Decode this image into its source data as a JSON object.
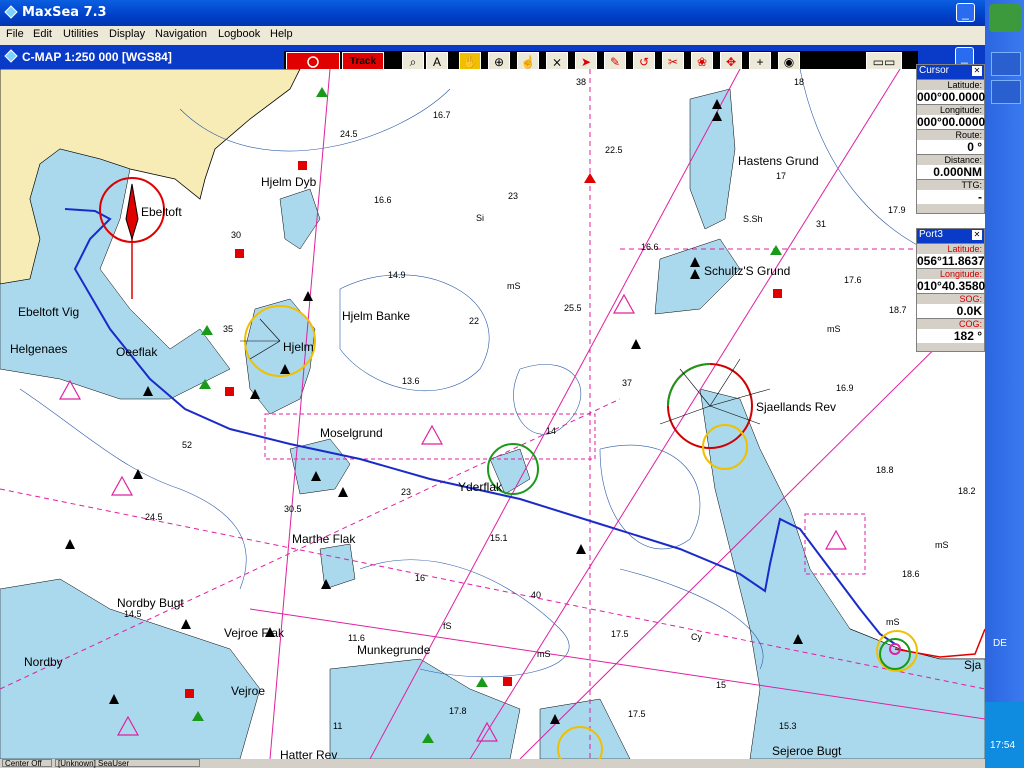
{
  "window": {
    "title": "MaxSea 7.3",
    "chart_title": "C-MAP  1:250 000 [WGS84]",
    "min_glyph": "_",
    "close_glyph": "✕"
  },
  "menu": [
    "File",
    "Edit",
    "Utilities",
    "Display",
    "Navigation",
    "Logbook",
    "Help"
  ],
  "toolbar": {
    "track_label": "Track on",
    "tools": [
      "search-icon",
      "compass-icon",
      "hand-icon",
      "crosshair-icon",
      "hand-pan-icon",
      "scissors-route-icon",
      "pointer-icon",
      "pencil-icon",
      "rotate-icon",
      "cut-icon",
      "network-icon",
      "move-icon",
      "plus-icon",
      "target-icon"
    ],
    "tool_glyphs": [
      "⌕",
      "A",
      "✋",
      "⊕",
      "☝",
      "⨯",
      "➤",
      "✎",
      "↺",
      "✂",
      "❀",
      "✥",
      "+",
      "◉"
    ]
  },
  "cursor_panel": {
    "title": "Cursor",
    "latitude_label": "Latitude:",
    "latitude_value": "000°00.0000",
    "longitude_label": "Longitude:",
    "longitude_value": "000°00.0000",
    "route_label": "Route:",
    "route_value": "0 °",
    "distance_label": "Distance:",
    "distance_value": "0.000NM",
    "ttg_label": "TTG:",
    "ttg_value": "-"
  },
  "port_panel": {
    "title": "Port3",
    "latitude_label": "Latitude:",
    "latitude_value": "056°11.8637",
    "longitude_label": "Longitude:",
    "longitude_value": "010°40.3580",
    "sog_label": "SOG:",
    "sog_value": "0.0K",
    "cog_label": "COG:",
    "cog_value": "182 °"
  },
  "map_labels": [
    "Hjelm Dyb",
    "Ebeltoft",
    "Hastens Grund",
    "Ebeltoft Vig",
    "Helgenaes",
    "Oeeflak",
    "Hjelm",
    "Hjelm Banke",
    "Schultz'S Grund",
    "Sjaellands Rev",
    "Moselgrund",
    "Yderflak",
    "Marthe Flak",
    "Nordby Bugt",
    "Vejroe Flak",
    "Nordby",
    "Vejroe",
    "Munkegrunde",
    "Hatter Rev",
    "Sejeroe Bugt",
    "Sja"
  ],
  "depths": [
    "38",
    "24.5",
    "16.7",
    "22.5",
    "18",
    "23",
    "17",
    "16.6",
    "S.Sh",
    "31",
    "17.9",
    "30",
    "16.6",
    "14.9",
    "mS",
    "25.5",
    "22",
    "17.6",
    "18.7",
    "35",
    "13.6",
    "37",
    "16.9",
    "mS",
    "14",
    "52",
    "18.8",
    "18.2",
    "23",
    "24.5",
    "30.5",
    "15.1",
    "mS",
    "14.5",
    "40",
    "11.6",
    "16",
    "fS",
    "17.5",
    "Cy",
    "18.6",
    "mS",
    "15",
    "17.8",
    "11",
    "17.5",
    "15.3",
    "mS",
    "Si"
  ],
  "statusbar": {
    "center_label": "Center Off",
    "user_label": "[Unknown] SeaUser"
  },
  "tray": {
    "language": "DE",
    "time": "17:54"
  },
  "colors": {
    "land_color": "#f7ecb5",
    "shallow_color": "#aad9ee",
    "route_color": "#1b2bc9",
    "magenta": "#e020a0"
  }
}
